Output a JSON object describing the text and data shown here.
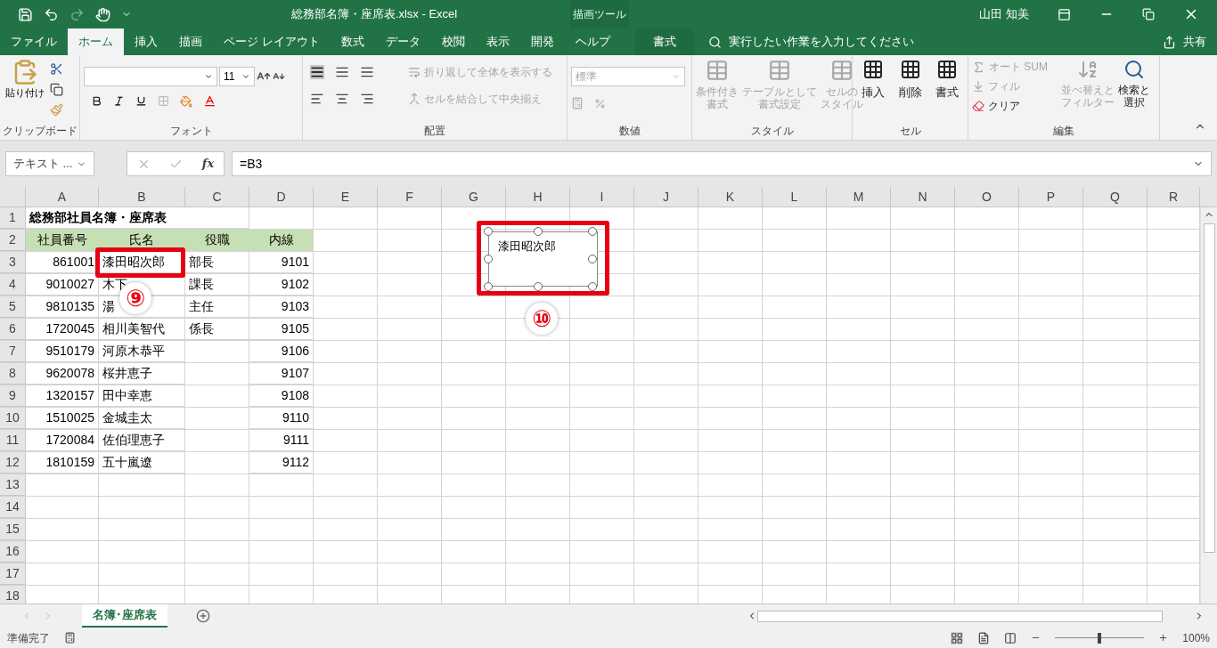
{
  "window": {
    "title": "総務部名簿・座席表.xlsx  -  Excel",
    "context_label": "描画ツール",
    "user": "山田 知美"
  },
  "ribbon_tabs": [
    {
      "label": "ファイル",
      "selected": false,
      "kind": "normal"
    },
    {
      "label": "ホーム",
      "selected": true,
      "kind": "normal"
    },
    {
      "label": "挿入",
      "selected": false,
      "kind": "normal"
    },
    {
      "label": "描画",
      "selected": false,
      "kind": "normal"
    },
    {
      "label": "ページ レイアウト",
      "selected": false,
      "kind": "normal"
    },
    {
      "label": "数式",
      "selected": false,
      "kind": "normal"
    },
    {
      "label": "データ",
      "selected": false,
      "kind": "normal"
    },
    {
      "label": "校閲",
      "selected": false,
      "kind": "normal"
    },
    {
      "label": "表示",
      "selected": false,
      "kind": "normal"
    },
    {
      "label": "開発",
      "selected": false,
      "kind": "normal"
    },
    {
      "label": "ヘルプ",
      "selected": false,
      "kind": "normal"
    },
    {
      "label": "書式",
      "selected": false,
      "kind": "context"
    }
  ],
  "tell_me": {
    "placeholder": "実行したい作業を入力してください"
  },
  "share": "共有",
  "ribbon": {
    "clipboard": {
      "label": "クリップボード",
      "paste": "貼り付け"
    },
    "font": {
      "label": "フォント",
      "size": "11"
    },
    "alignment": {
      "label": "配置",
      "wrap": {
        "text": "折り返して全体を表示する",
        "disabled": true
      },
      "merge": {
        "text": "セルを結合して中央揃え",
        "disabled": true
      }
    },
    "number": {
      "label": "数値",
      "format": {
        "value": "標準",
        "disabled": true
      }
    },
    "styles": {
      "label": "スタイル",
      "items": [
        {
          "lines": [
            "条件付き",
            "書式"
          ],
          "disabled": true
        },
        {
          "lines": [
            "テーブルとして",
            "書式設定"
          ],
          "disabled": true
        },
        {
          "lines": [
            "セルの",
            "スタイル"
          ],
          "disabled": true
        }
      ]
    },
    "cells": {
      "label": "セル",
      "items": [
        {
          "text": "挿入",
          "disabled": false
        },
        {
          "text": "削除",
          "disabled": false
        },
        {
          "text": "書式",
          "disabled": false
        }
      ]
    },
    "editing": {
      "label": "編集",
      "autosum": {
        "text": "オート SUM",
        "disabled": true
      },
      "fill": {
        "text": "フィル",
        "disabled": true
      },
      "clear": {
        "text": "クリア",
        "disabled": false
      },
      "sort": {
        "lines": [
          "並べ替えと",
          "フィルター"
        ],
        "disabled": true
      },
      "find": {
        "lines": [
          "検索と",
          "選択"
        ],
        "disabled": false
      }
    }
  },
  "formula_bar": {
    "name_box": "テキスト ...",
    "function_label": "fx",
    "formula": "=B3"
  },
  "sheet": {
    "columns": [
      "A",
      "B",
      "C",
      "D",
      "E",
      "F",
      "G",
      "H",
      "I",
      "J",
      "K",
      "L",
      "M",
      "N",
      "O",
      "P",
      "Q",
      "R"
    ],
    "rows": [
      {
        "number": "1",
        "kind": "title",
        "heading": "総務部社員名簿・座席表"
      },
      {
        "number": "2",
        "kind": "header",
        "id": "社員番号",
        "name": "氏名",
        "title": "役職",
        "ext": "内線"
      },
      {
        "number": "3",
        "kind": "data",
        "id": "861001",
        "name": "漆田昭次郎",
        "title": "部長",
        "ext": "9101"
      },
      {
        "number": "4",
        "kind": "data",
        "id": "9010027",
        "name": "木下",
        "title": "課長",
        "ext": "9102"
      },
      {
        "number": "5",
        "kind": "data",
        "id": "9810135",
        "name": "湯",
        "title": "主任",
        "ext": "9103"
      },
      {
        "number": "6",
        "kind": "data",
        "id": "1720045",
        "name": "相川美智代",
        "title": "係長",
        "ext": "9105"
      },
      {
        "number": "7",
        "kind": "data",
        "id": "9510179",
        "name": "河原木恭平",
        "ext": "9106"
      },
      {
        "number": "8",
        "kind": "data",
        "id": "9620078",
        "name": "桜井恵子",
        "ext": "9107"
      },
      {
        "number": "9",
        "kind": "data",
        "id": "1320157",
        "name": "田中幸恵",
        "ext": "9108"
      },
      {
        "number": "10",
        "kind": "data",
        "id": "1510025",
        "name": "金城圭太",
        "ext": "9110"
      },
      {
        "number": "11",
        "kind": "data",
        "id": "1720084",
        "name": "佐伯理恵子",
        "ext": "9111"
      },
      {
        "number": "12",
        "kind": "data",
        "id": "1810159",
        "name": "五十嵐遼",
        "ext": "9112"
      },
      {
        "number": "13",
        "kind": "empty"
      },
      {
        "number": "14",
        "kind": "empty"
      },
      {
        "number": "15",
        "kind": "empty"
      },
      {
        "number": "16",
        "kind": "empty"
      },
      {
        "number": "17",
        "kind": "empty"
      },
      {
        "number": "18",
        "kind": "empty"
      }
    ],
    "shape": {
      "text": "漆田昭次郎",
      "selected": true
    }
  },
  "annotations": [
    {
      "label": "⑨"
    },
    {
      "label": "⑩"
    }
  ],
  "sheet_tabs": [
    {
      "label": "名簿･座席表",
      "selected": true
    }
  ],
  "status_bar": {
    "status": "準備完了",
    "zoom": "100%",
    "zoom_level": {
      "level": 0.5
    }
  }
}
